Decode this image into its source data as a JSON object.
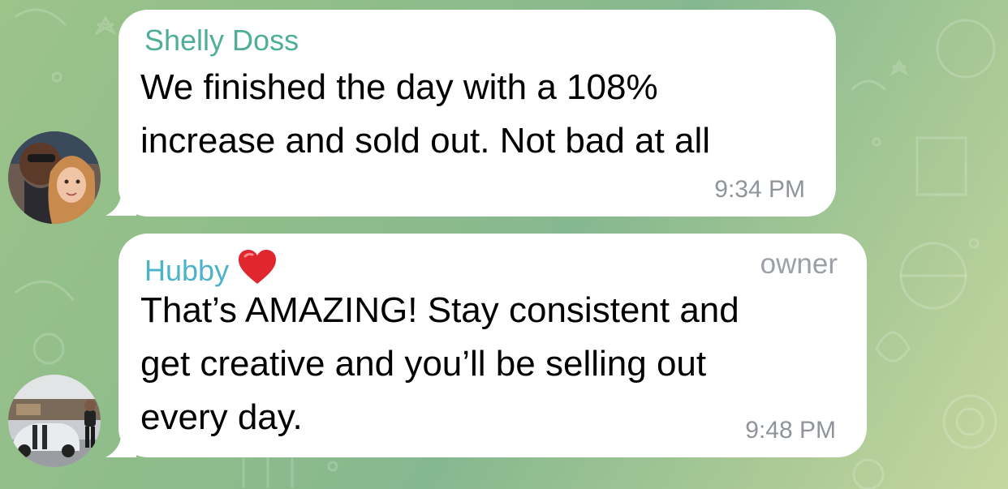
{
  "chat": {
    "background_color": "#8fbd8a",
    "messages": [
      {
        "sender": "Shelly Doss",
        "sender_color": "#4fae97",
        "text": "We finished the day with a 108%\nincrease and sold out. Not bad at all",
        "time": "9:34 PM",
        "avatar": "couple-photo-avatar"
      },
      {
        "sender": "Hubby",
        "sender_emoji": "heart-icon",
        "sender_color": "#4db3c8",
        "role": "owner",
        "text": "That’s AMAZING! Stay consistent and\nget creative and you’ll be selling out\nevery day.",
        "time": "9:48 PM",
        "avatar": "car-photo-avatar"
      }
    ]
  }
}
